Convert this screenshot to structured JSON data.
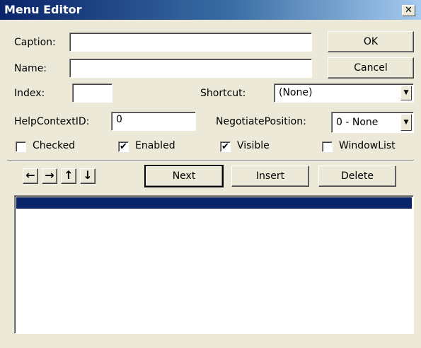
{
  "window": {
    "title": "Menu Editor",
    "close_label": "✕"
  },
  "fields": {
    "caption_label": "Caption:",
    "caption_value": "",
    "name_label": "Name:",
    "name_value": "",
    "index_label": "Index:",
    "index_value": "",
    "shortcut_label": "Shortcut:",
    "shortcut_value": "(None)",
    "helpcontext_label": "HelpContextID:",
    "helpcontext_value": "0",
    "negotiate_label": "NegotiatePosition:",
    "negotiate_value": "0 - None"
  },
  "checkboxes": {
    "checked": {
      "label": "Checked",
      "checked": false
    },
    "enabled": {
      "label": "Enabled",
      "checked": true
    },
    "visible": {
      "label": "Visible",
      "checked": true
    },
    "windowlist": {
      "label": "WindowList",
      "checked": false
    }
  },
  "buttons": {
    "ok": "OK",
    "cancel": "Cancel",
    "next": "Next",
    "insert": "Insert",
    "delete": "Delete"
  },
  "arrow_buttons": {
    "left": "←",
    "right": "→",
    "up": "↑",
    "down": "↓"
  },
  "icons": {
    "combo_arrow": "▼",
    "check_mark": "✔"
  },
  "colors": {
    "title_gradient_start": "#0a246a",
    "selection": "#0a246a",
    "face": "#ece9d8"
  }
}
